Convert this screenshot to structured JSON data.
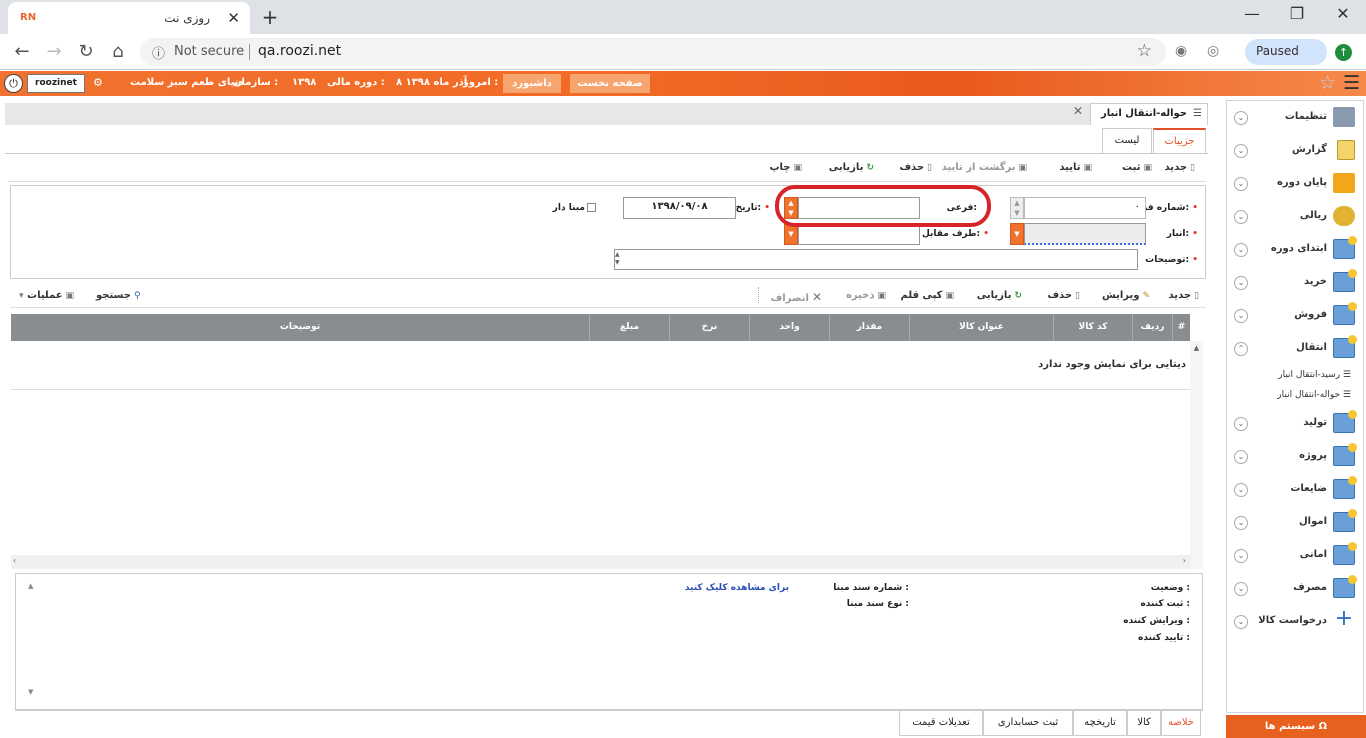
{
  "browser": {
    "tab_title": "روزی نت",
    "tab_favicon": "RN",
    "not_secure": "Not secure",
    "url": "qa.roozi.net",
    "paused": "Paused"
  },
  "header": {
    "username": "roozinet",
    "org_label": "سازمان :",
    "org_value": "دنیای طعم سبز سلامت",
    "fiscal_label": "دوره مالی :",
    "fiscal_value": "۱۳۹۸",
    "today_label": "امروز :",
    "today_value": "۸ آذر ماه ۱۳۹۸",
    "dashboard": "داشبورد",
    "home": "صفحه نخست"
  },
  "sidebar": {
    "items": [
      {
        "label": "تنظیمات",
        "icon": "settings-icon"
      },
      {
        "label": "گزارش",
        "icon": "report-icon"
      },
      {
        "label": "پایان دوره",
        "icon": "period-end-icon"
      },
      {
        "label": "ریالی",
        "icon": "money-icon"
      },
      {
        "label": "ابتدای دوره",
        "icon": "grid-icon"
      },
      {
        "label": "خرید",
        "icon": "grid-icon"
      },
      {
        "label": "فروش",
        "icon": "grid-icon"
      },
      {
        "label": "انتقال",
        "icon": "grid-icon"
      },
      {
        "label": "تولید",
        "icon": "grid-icon"
      },
      {
        "label": "پروژه",
        "icon": "grid-icon"
      },
      {
        "label": "ضایعات",
        "icon": "grid-icon"
      },
      {
        "label": "اموال",
        "icon": "grid-icon"
      },
      {
        "label": "امانی",
        "icon": "grid-icon"
      },
      {
        "label": "مصرف",
        "icon": "grid-icon"
      },
      {
        "label": "درخواست کالا",
        "icon": "plus-icon"
      }
    ],
    "subitems": [
      "رسید-انتقال انبار",
      "حواله-انتقال انبار"
    ],
    "system_button": "سیستم ها"
  },
  "page": {
    "title": "حواله-انتقال انبار",
    "tabs": {
      "details": "جزییات",
      "list": "لیست"
    }
  },
  "toolbar1": {
    "new": "جدید",
    "save": "ثبت",
    "approve": "تایید",
    "unapprove": "برگشت از تایید",
    "delete": "حذف",
    "refresh": "بازیابی",
    "print": "چاپ"
  },
  "form": {
    "form_number_label": "شماره فرم:",
    "form_number_value": "۰",
    "sub_label": "فرعی:",
    "sub_value": "",
    "date_label": "تاریخ:",
    "date_value": "۱۳۹۸/۰۹/۰۸",
    "has_base_label": "مبنا دار",
    "warehouse_label": "انبار:",
    "counterparty_label": "طرف مقابل:",
    "description_label": "توضیحات:"
  },
  "toolbar2": {
    "new": "جدید",
    "edit": "ویرایش",
    "delete": "حذف",
    "refresh": "بازیابی",
    "copy_item": "کپی قلم",
    "save": "ذخیره",
    "cancel": "انصراف",
    "search": "جستجو",
    "operations": "عملیات"
  },
  "grid": {
    "columns": [
      "#",
      "ردیف",
      "کد کالا",
      "عنوان کالا",
      "مقدار",
      "واحد",
      "نرخ",
      "مبلغ",
      "توضیحات"
    ],
    "empty_message": "دیتایی برای نمایش وجود ندارد"
  },
  "footer": {
    "status_label": "وضعیت :",
    "registrar_label": "ثبت کننده :",
    "editor_label": "ویرایش کننده :",
    "approver_label": "تایید کننده :",
    "base_doc_number_label": "شماره سند مبنا :",
    "base_doc_type_label": "نوع سند مبنا :",
    "click_to_view": "برای مشاهده کلیک کنید"
  },
  "bottom_tabs": [
    "خلاصه",
    "کالا",
    "تاریخچه",
    "ثبت حسابداری",
    "تعدیلات قیمت"
  ],
  "colors": {
    "accent": "#f0722e",
    "highlight_oval": "#d62428"
  }
}
